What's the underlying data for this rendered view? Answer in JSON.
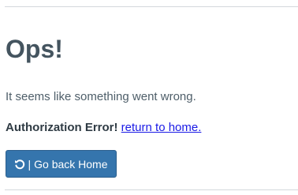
{
  "page": {
    "title": "Ops!",
    "message": "It seems like something went wrong.",
    "error_label": "Authorization Error!",
    "link_text": "return to home.",
    "button": {
      "separator": "|",
      "label": "Go back Home",
      "icon": "undo-icon"
    }
  },
  "colors": {
    "button_bg": "#3575ad",
    "link": "#1a1ae6",
    "heading": "#44545f"
  }
}
